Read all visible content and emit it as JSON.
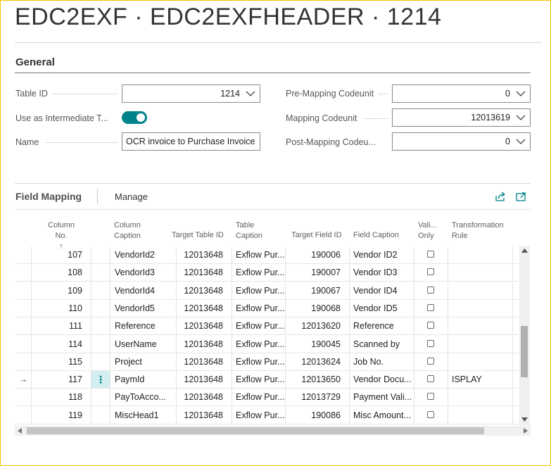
{
  "page": {
    "title": "EDC2EXF · EDC2EXFHEADER · 1214"
  },
  "general": {
    "section_title": "General",
    "table_id": {
      "label": "Table ID",
      "value": "1214"
    },
    "use_intermediate": {
      "label": "Use as Intermediate T...",
      "value": true
    },
    "name": {
      "label": "Name",
      "value": "OCR invoice to Purchase Invoice"
    },
    "pre_mapping": {
      "label": "Pre-Mapping Codeunit",
      "value": "0"
    },
    "mapping": {
      "label": "Mapping Codeunit",
      "value": "12013619"
    },
    "post_mapping": {
      "label": "Post-Mapping Codeu...",
      "value": "0"
    }
  },
  "field_mapping": {
    "title": "Field Mapping",
    "manage": "Manage",
    "icons": [
      "share-icon",
      "expand-icon"
    ],
    "columns": {
      "column_no": [
        "Column No.",
        "↑"
      ],
      "column_caption": [
        "Column",
        "Caption"
      ],
      "target_table_id": "Target Table ID",
      "table_caption": [
        "Table",
        "Caption"
      ],
      "target_field_id": "Target Field ID",
      "field_caption": "Field Caption",
      "validate_only": [
        "Vali...",
        "Only"
      ],
      "transformation_rule": [
        "Transformation",
        "Rule"
      ]
    },
    "rows": [
      {
        "no": "107",
        "caption": "VendorId2",
        "table_id": "12013648",
        "table_caption": "Exflow Pur...",
        "field_id": "190006",
        "field_caption": "Vendor ID2",
        "rule": ""
      },
      {
        "no": "108",
        "caption": "VendorId3",
        "table_id": "12013648",
        "table_caption": "Exflow Pur...",
        "field_id": "190007",
        "field_caption": "Vendor ID3",
        "rule": ""
      },
      {
        "no": "109",
        "caption": "VendorId4",
        "table_id": "12013648",
        "table_caption": "Exflow Pur...",
        "field_id": "190067",
        "field_caption": "Vendor ID4",
        "rule": ""
      },
      {
        "no": "110",
        "caption": "VendorId5",
        "table_id": "12013648",
        "table_caption": "Exflow Pur...",
        "field_id": "190068",
        "field_caption": "Vendor ID5",
        "rule": ""
      },
      {
        "no": "111",
        "caption": "Reference",
        "table_id": "12013648",
        "table_caption": "Exflow Pur...",
        "field_id": "12013620",
        "field_caption": "Reference",
        "rule": ""
      },
      {
        "no": "114",
        "caption": "UserName",
        "table_id": "12013648",
        "table_caption": "Exflow Pur...",
        "field_id": "190045",
        "field_caption": "Scanned by",
        "rule": ""
      },
      {
        "no": "115",
        "caption": "Project",
        "table_id": "12013648",
        "table_caption": "Exflow Pur...",
        "field_id": "12013624",
        "field_caption": "Job No.",
        "rule": ""
      },
      {
        "no": "117",
        "caption": "PaymId",
        "table_id": "12013648",
        "table_caption": "Exflow Pur...",
        "field_id": "12013650",
        "field_caption": "Vendor Docu...",
        "rule": "ISPLAY",
        "selected": true
      },
      {
        "no": "118",
        "caption": "PayToAcco...",
        "table_id": "12013648",
        "table_caption": "Exflow Pur...",
        "field_id": "12013729",
        "field_caption": "Payment Vali...",
        "rule": ""
      },
      {
        "no": "119",
        "caption": "MiscHead1",
        "table_id": "12013648",
        "table_caption": "Exflow Pur...",
        "field_id": "190086",
        "field_caption": "Misc Amount...",
        "rule": ""
      }
    ]
  },
  "colors": {
    "accent": "#00838a",
    "selected_cell": "#d3eef0",
    "frame": "#f2c200"
  }
}
